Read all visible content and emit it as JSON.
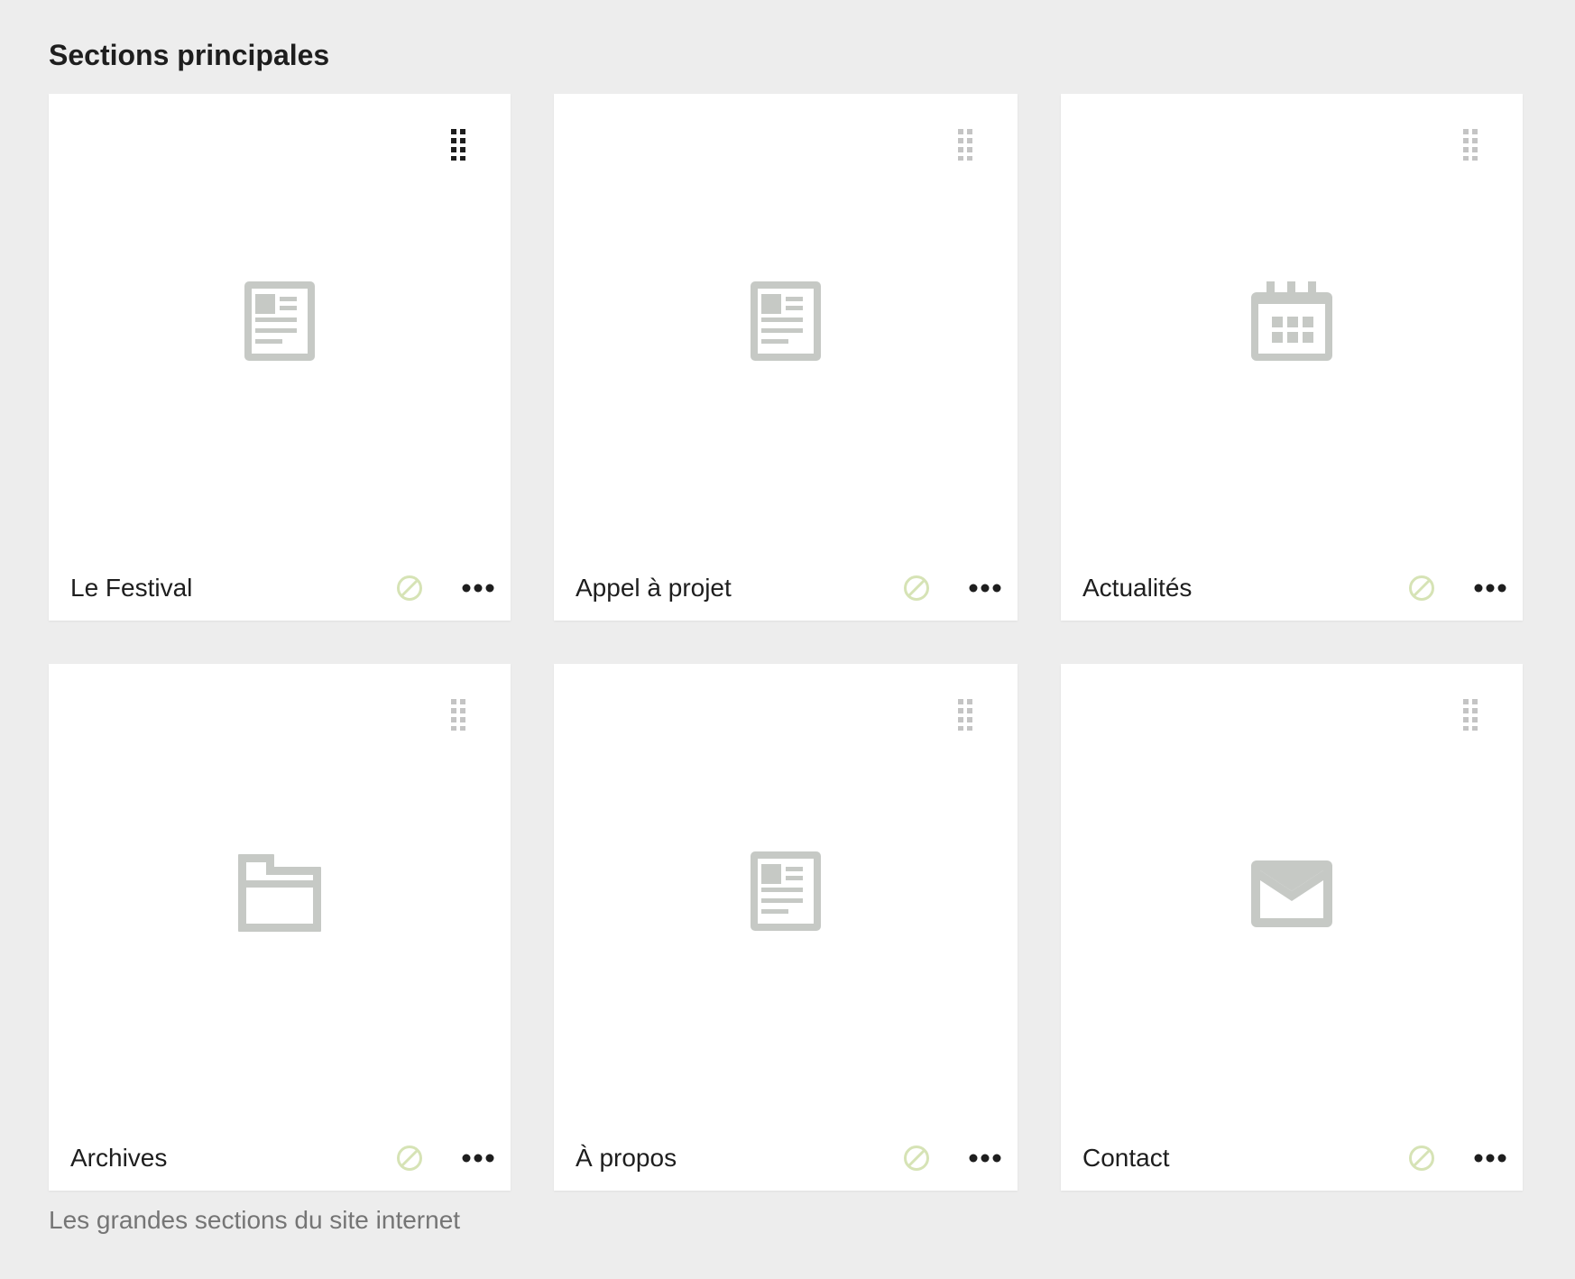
{
  "section": {
    "title": "Sections principales",
    "help_text": "Les grandes sections du site internet"
  },
  "colors": {
    "background": "#ededed",
    "card": "#ffffff",
    "icon_gray": "#c6c9c5",
    "status_green": "#d6e3b5",
    "drag_active": "#1e1e1e",
    "drag_inactive": "#c4c4c4"
  },
  "cards": [
    {
      "label": "Le Festival",
      "icon": "page-icon",
      "drag_active": true
    },
    {
      "label": "Appel à projet",
      "icon": "page-icon",
      "drag_active": false
    },
    {
      "label": "Actualités",
      "icon": "calendar-icon",
      "drag_active": false
    },
    {
      "label": "Archives",
      "icon": "folder-icon",
      "drag_active": false
    },
    {
      "label": "À propos",
      "icon": "page-icon",
      "drag_active": false
    },
    {
      "label": "Contact",
      "icon": "envelope-icon",
      "drag_active": false
    }
  ]
}
